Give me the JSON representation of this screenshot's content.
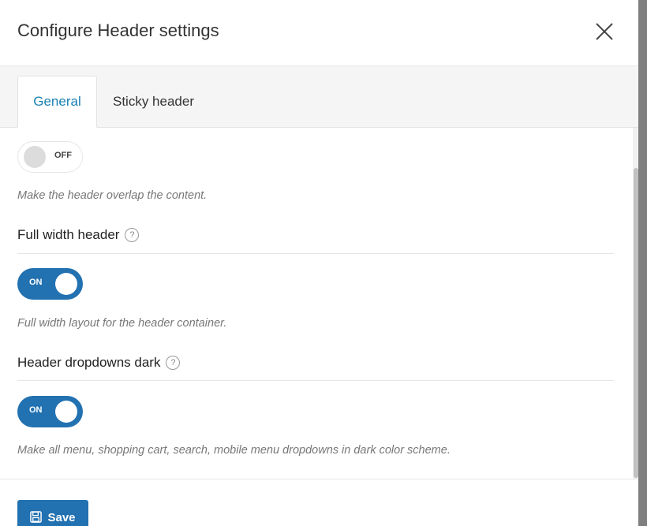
{
  "modal": {
    "title": "Configure Header settings",
    "close_icon": "close-icon"
  },
  "tabs": [
    {
      "label": "General",
      "active": true
    },
    {
      "label": "Sticky header",
      "active": false
    }
  ],
  "settings": {
    "overlap": {
      "state_label": "OFF",
      "enabled": false,
      "description": "Make the header overlap the content."
    },
    "full_width": {
      "label": "Full width header",
      "help": "?",
      "state_label": "ON",
      "enabled": true,
      "description": "Full width layout for the header container."
    },
    "dropdowns_dark": {
      "label": "Header dropdowns dark",
      "help": "?",
      "state_label": "ON",
      "enabled": true,
      "description": "Make all menu, shopping cart, search, mobile menu dropdowns in dark color scheme."
    }
  },
  "footer": {
    "save_label": "Save",
    "save_icon": "floppy-disk-icon"
  },
  "colors": {
    "accent": "#2271b1",
    "active_tab_text": "#1a81b5"
  }
}
